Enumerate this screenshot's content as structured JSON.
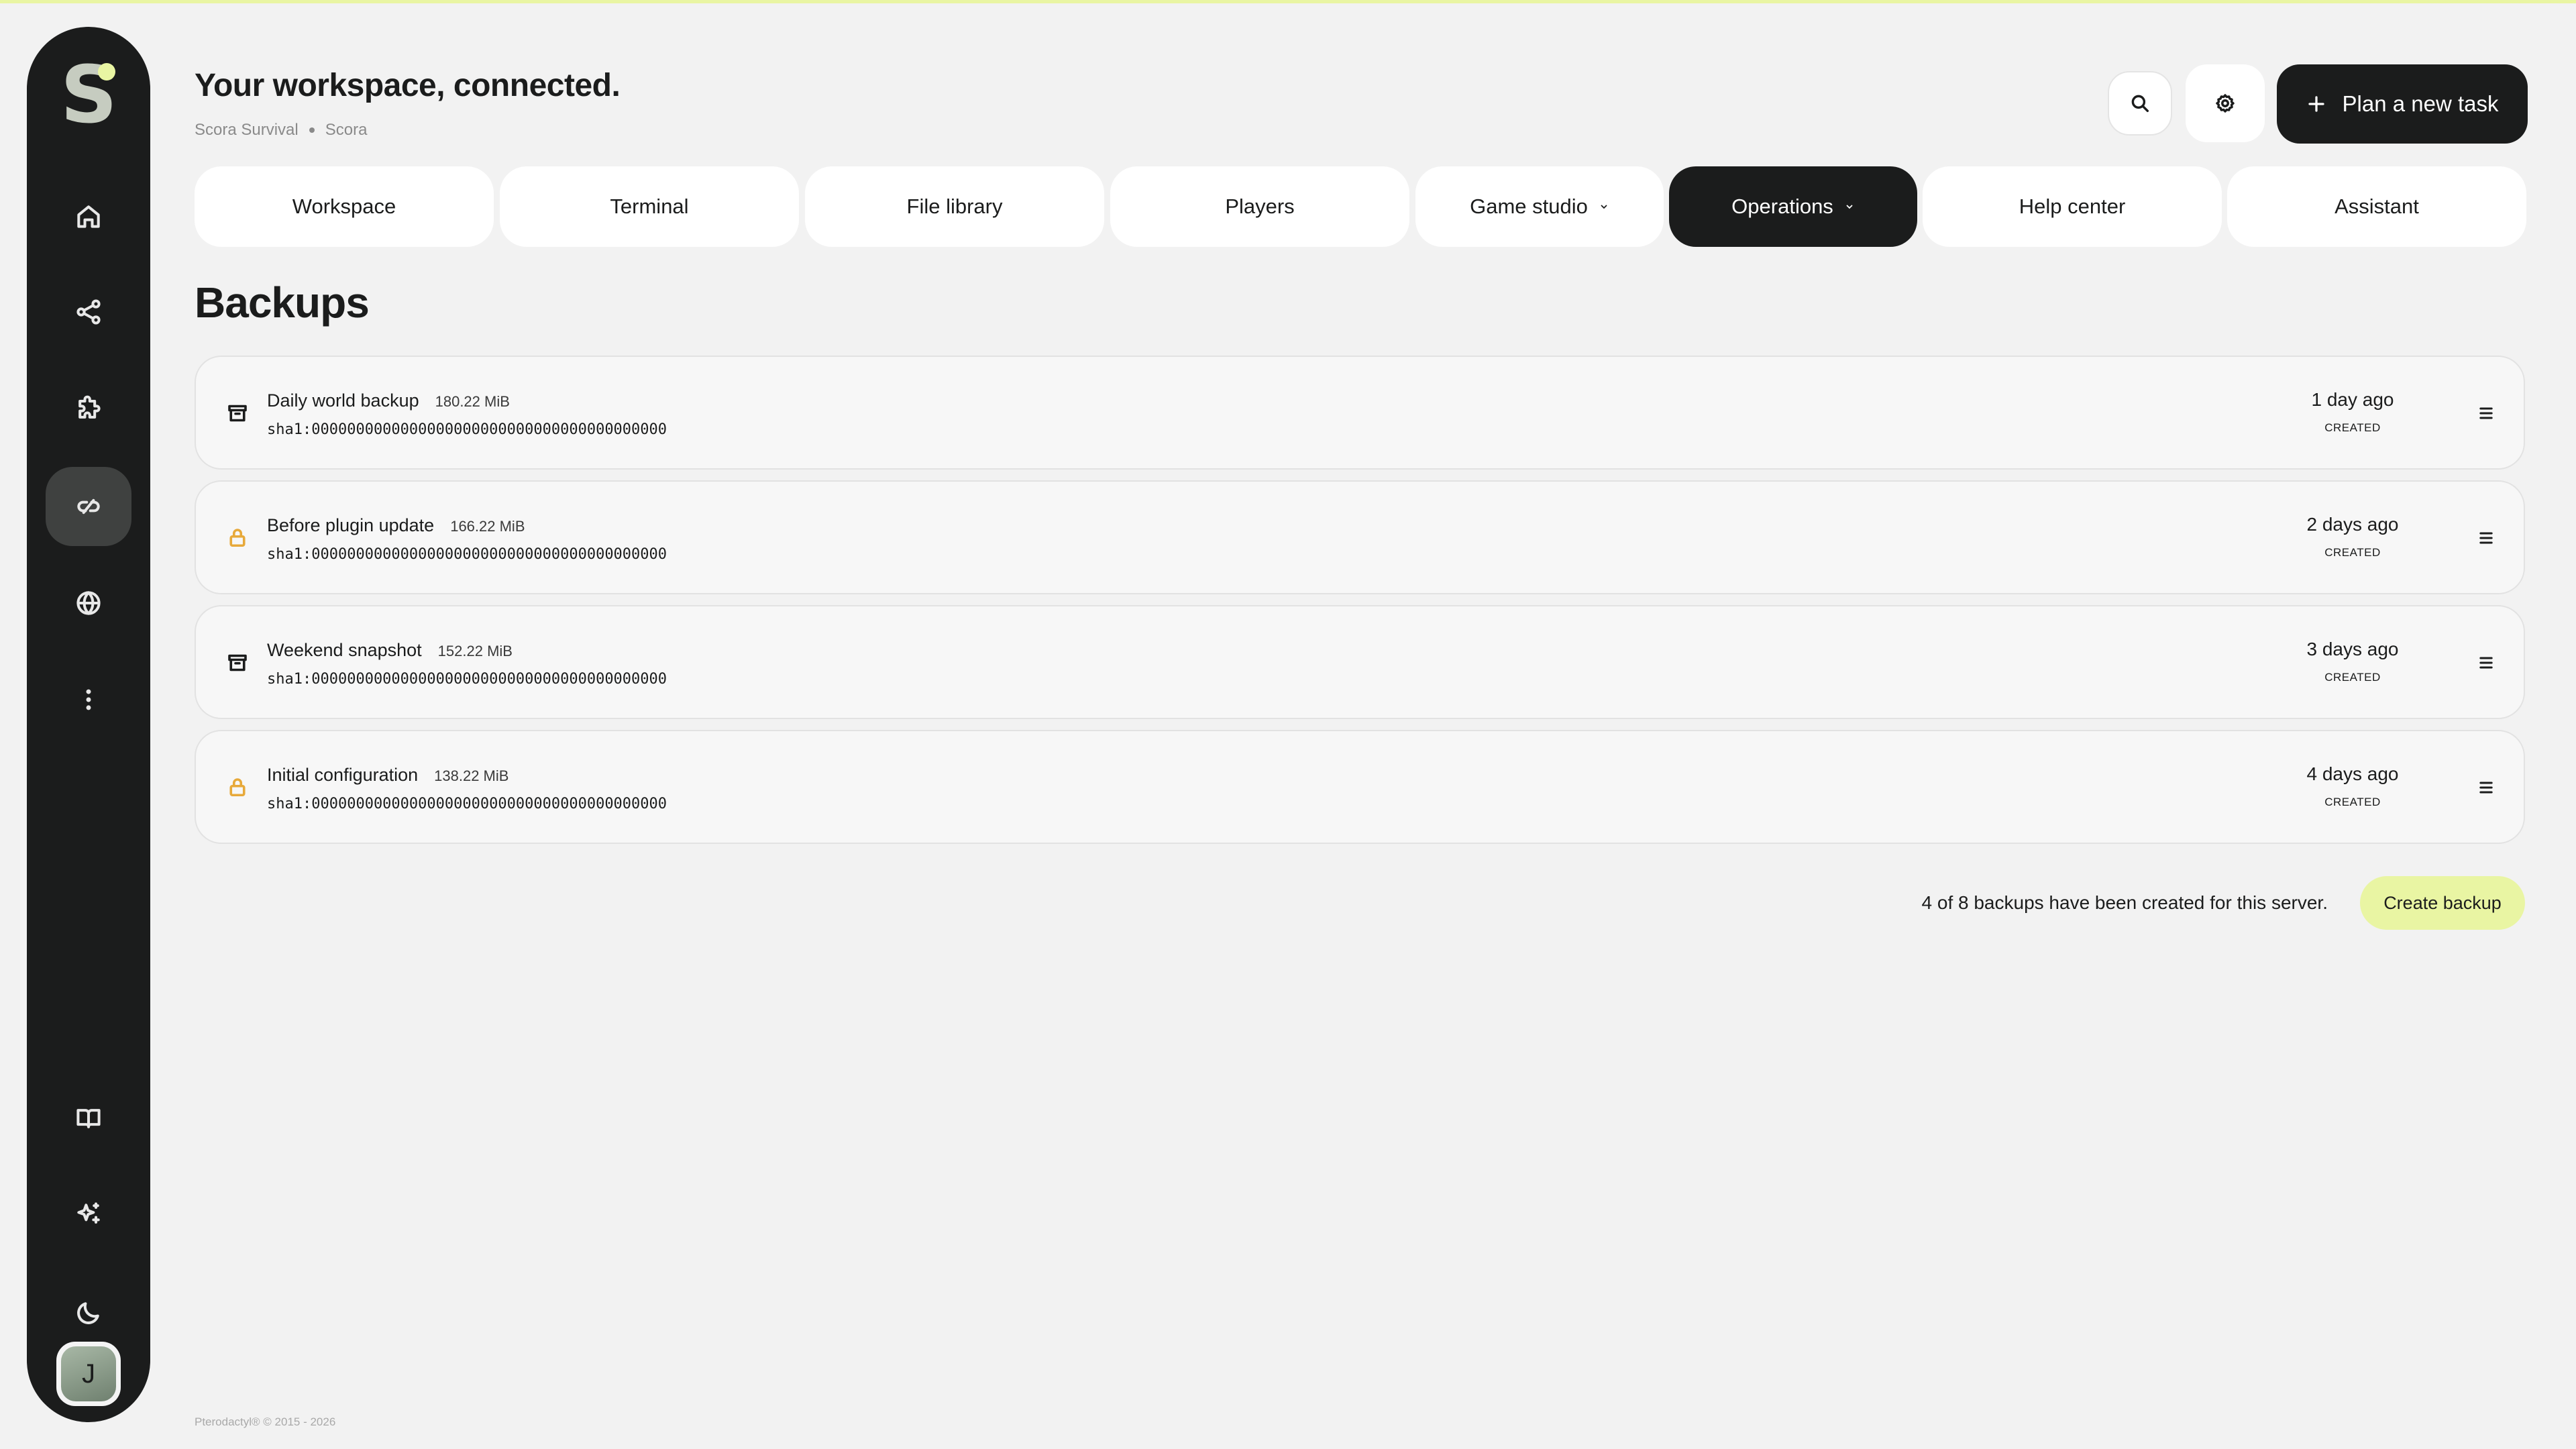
{
  "header": {
    "title": "Your workspace, connected.",
    "breadcrumb": [
      "Scora Survival",
      "Scora"
    ],
    "plan_task_label": "Plan a new task"
  },
  "sidebar": {
    "logo_letter": "S",
    "items": [
      {
        "icon": "home-icon"
      },
      {
        "icon": "share-icon"
      },
      {
        "icon": "puzzle-icon"
      },
      {
        "icon": "link-icon",
        "active": true
      },
      {
        "icon": "globe-icon"
      },
      {
        "icon": "more-vertical-icon"
      }
    ],
    "bottom_items": [
      {
        "icon": "book-icon"
      },
      {
        "icon": "sparkles-icon"
      },
      {
        "icon": "moon-icon"
      }
    ],
    "avatar_initial": "J"
  },
  "tabs": [
    {
      "label": "Workspace"
    },
    {
      "label": "Terminal"
    },
    {
      "label": "File library"
    },
    {
      "label": "Players"
    },
    {
      "label": "Game studio",
      "dropdown": true
    },
    {
      "label": "Operations",
      "dropdown": true,
      "active": true
    },
    {
      "label": "Help center"
    },
    {
      "label": "Assistant"
    }
  ],
  "section": {
    "title": "Backups"
  },
  "backups": [
    {
      "name": "Daily world backup",
      "size": "180.22 MiB",
      "hash": "sha1:0000000000000000000000000000000000000000",
      "when": "1 day ago",
      "status": "CREATED",
      "icon": "archive-icon"
    },
    {
      "name": "Before plugin update",
      "size": "166.22 MiB",
      "hash": "sha1:0000000000000000000000000000000000000000",
      "when": "2 days ago",
      "status": "CREATED",
      "icon": "lock-icon"
    },
    {
      "name": "Weekend snapshot",
      "size": "152.22 MiB",
      "hash": "sha1:0000000000000000000000000000000000000000",
      "when": "3 days ago",
      "status": "CREATED",
      "icon": "archive-icon"
    },
    {
      "name": "Initial configuration",
      "size": "138.22 MiB",
      "hash": "sha1:0000000000000000000000000000000000000000",
      "when": "4 days ago",
      "status": "CREATED",
      "icon": "lock-icon"
    }
  ],
  "summary": "4 of 8 backups have been created for this server.",
  "create_backup_label": "Create backup",
  "footer": "Pterodactyl® © 2015 - 2026",
  "colors": {
    "sidebar_bg": "#1b1c1c",
    "accent": "#e9f5a3",
    "lock": "#e7a93a",
    "page_bg": "#f2f2f2"
  }
}
